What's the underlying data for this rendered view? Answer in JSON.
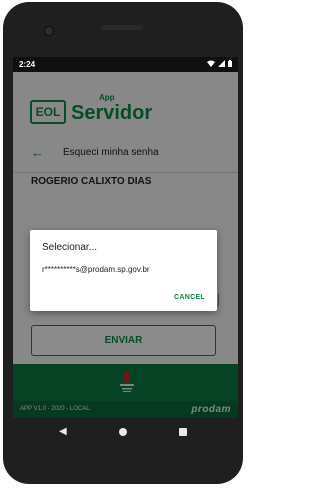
{
  "status_bar": {
    "time": "2:24",
    "icons": [
      "wifi-icon",
      "signal-icon",
      "battery-icon"
    ]
  },
  "logo": {
    "badge": "EOL",
    "app_label": "App",
    "name": "Servidor"
  },
  "nav": {
    "back_icon": "back-arrow-icon",
    "title": "Esqueci minha senha"
  },
  "user": {
    "name": "ROGERIO CALIXTO DIAS"
  },
  "form": {
    "send_label": "ENVIAR"
  },
  "dialog": {
    "title": "Selecionar...",
    "option": "r**********s@prodam.sp.gov.br",
    "cancel_label": "CANCEL"
  },
  "footer": {
    "version": "APP V1.0 - 2020 - LOCAL.",
    "brand": "prodam"
  },
  "colors": {
    "accent": "#0b8a47",
    "footer_dark": "#0b6b3b"
  }
}
